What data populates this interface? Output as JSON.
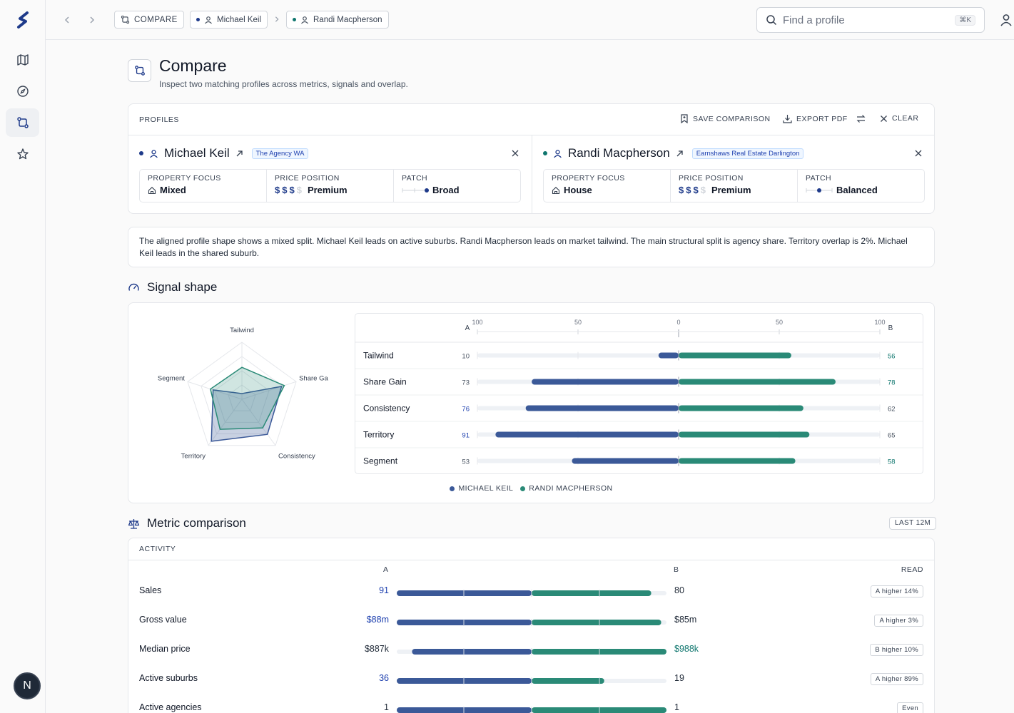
{
  "colors": {
    "a": "#3b5998",
    "b": "#2a8a77",
    "accent": "#1e3a8a"
  },
  "sidebar": {
    "logo": "s-logo-icon",
    "items": [
      {
        "icon": "map-icon",
        "active": false
      },
      {
        "icon": "compass-icon",
        "active": false
      },
      {
        "icon": "compare-icon",
        "active": true
      },
      {
        "icon": "star-icon",
        "active": false
      }
    ],
    "avatar_initial": "N"
  },
  "topbar": {
    "crumbs": [
      {
        "label": "COMPARE",
        "icon": "compare-icon"
      },
      {
        "label": "Michael Keil",
        "icon": "user-icon",
        "dot": "a"
      },
      {
        "label": "Randi Macpherson",
        "icon": "user-icon",
        "dot": "b"
      }
    ],
    "search_placeholder": "Find a profile",
    "search_shortcut": "⌘K"
  },
  "header": {
    "title": "Compare",
    "subtitle": "Inspect two matching profiles across metrics, signals and overlap."
  },
  "profiles": {
    "label": "PROFILES",
    "actions": {
      "save": "SAVE COMPARISON",
      "export": "EXPORT PDF",
      "clear": "CLEAR"
    },
    "a": {
      "name": "Michael Keil",
      "agency": "The Agency WA",
      "focus_label": "PROPERTY FOCUS",
      "focus": "Mixed",
      "price_label": "PRICE POSITION",
      "price": "Premium",
      "price_level": 3,
      "patch_label": "PATCH",
      "patch": "Broad"
    },
    "b": {
      "name": "Randi Macpherson",
      "agency": "Earnshaws Real Estate Darlington",
      "focus_label": "PROPERTY FOCUS",
      "focus": "House",
      "price_label": "PRICE POSITION",
      "price": "Premium",
      "price_level": 3,
      "patch_label": "PATCH",
      "patch": "Balanced"
    }
  },
  "summary": "The aligned profile shape shows a mixed split. Michael Keil leads on active suburbs. Randi Macpherson leads on market tailwind. The main structural split is agency share. Territory overlap is 2%. Michael Keil leads in the shared suburb.",
  "signal": {
    "title": "Signal shape",
    "axis_a": "A",
    "axis_b": "B",
    "ticks": [
      "100",
      "50",
      "0",
      "50",
      "100"
    ],
    "legend": [
      "MICHAEL KEIL",
      "RANDI MACPHERSON"
    ]
  },
  "chart_data": {
    "type": "bar",
    "categories": [
      "Tailwind",
      "Share Gain",
      "Consistency",
      "Territory",
      "Segment"
    ],
    "series": [
      {
        "name": "MICHAEL KEIL",
        "values": [
          10,
          73,
          76,
          91,
          53
        ]
      },
      {
        "name": "RANDI MACPHERSON",
        "values": [
          56,
          78,
          62,
          65,
          58
        ]
      }
    ],
    "xlim": [
      -100,
      100
    ]
  },
  "metric": {
    "title": "Metric comparison",
    "period": "LAST 12M",
    "group": "ACTIVITY",
    "col_a": "A",
    "col_b": "B",
    "col_read": "READ",
    "rows": [
      {
        "name": "Sales",
        "a": "91",
        "b": "80",
        "read": "A higher  14%",
        "win": "a",
        "a_share": 0.53,
        "b_share": 0.47
      },
      {
        "name": "Gross value",
        "a": "$88m",
        "b": "$85m",
        "read": "A higher  3%",
        "win": "a",
        "a_share": 0.51,
        "b_share": 0.49
      },
      {
        "name": "Median price",
        "a": "$887k",
        "b": "$988k",
        "read": "B higher  10%",
        "win": "b",
        "a_share": 0.47,
        "b_share": 0.53
      },
      {
        "name": "Active suburbs",
        "a": "36",
        "b": "19",
        "read": "A higher  89%",
        "win": "a",
        "a_share": 0.65,
        "b_share": 0.35
      },
      {
        "name": "Active agencies",
        "a": "1",
        "b": "1",
        "read": "Even",
        "win": "none",
        "a_share": 0.5,
        "b_share": 0.5
      }
    ]
  }
}
